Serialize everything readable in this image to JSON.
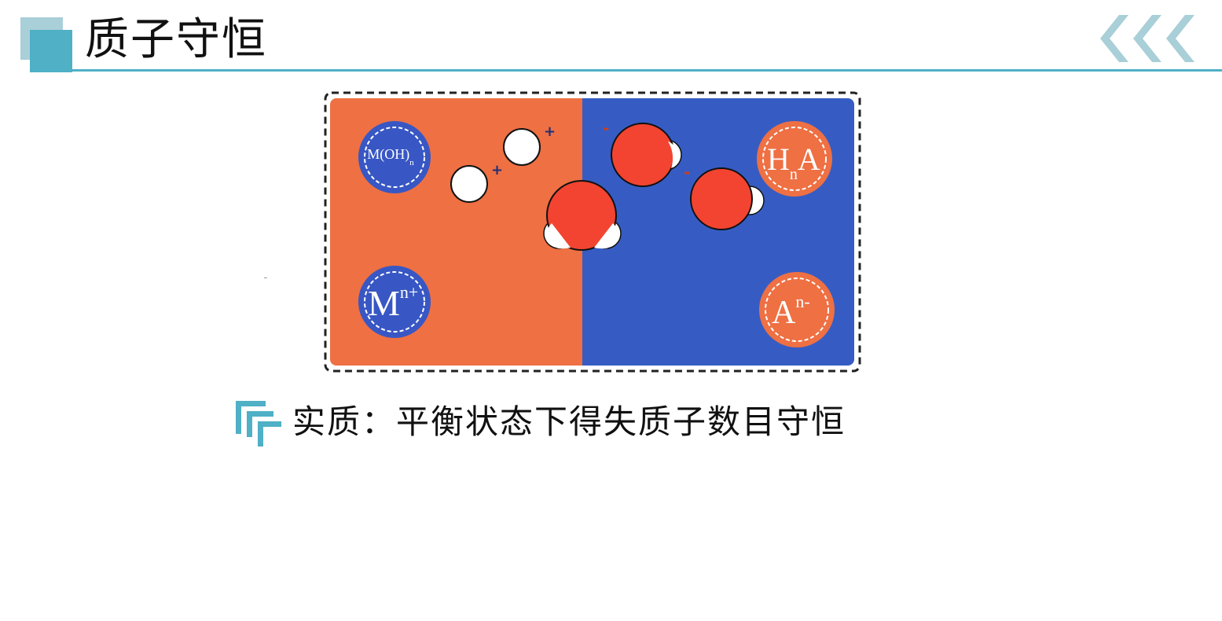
{
  "header": {
    "title": "质子守恒",
    "accent_color": "#4fb0c6",
    "decor_icon": "back-chevrons-icon"
  },
  "diagram": {
    "left_color": "#ee7043",
    "right_color": "#365cc4",
    "labels": {
      "base_molecule": "M(OH)",
      "base_molecule_sub": "n",
      "cation": "M",
      "cation_sup": "n+",
      "acid_molecule_h": "H",
      "acid_molecule_sub": "n",
      "acid_molecule_a": "A",
      "anion": "A",
      "anion_sup": "n-"
    },
    "charges": {
      "proton_1": "+",
      "proton_2": "+",
      "hydroxide_1": "-",
      "hydroxide_2": "-"
    }
  },
  "caption": {
    "text": "实质：平衡状态下得失质子数目守恒",
    "icon": "corner-brackets-icon"
  }
}
